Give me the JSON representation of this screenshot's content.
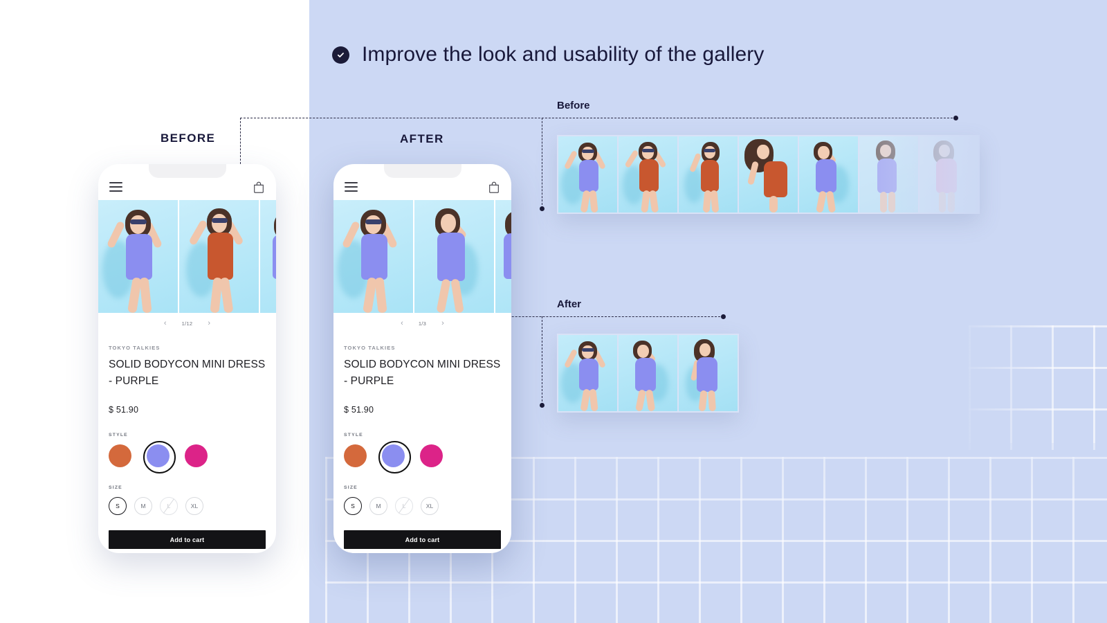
{
  "headline": {
    "icon": "check-circle-icon",
    "text": "Improve the look and usability of the gallery"
  },
  "labels": {
    "before": "BEFORE",
    "after": "AFTER",
    "strip_before": "Before",
    "strip_after": "After"
  },
  "colors": {
    "panel_background": "#ccd8f4",
    "page_background": "#ffffff",
    "ink": "#18183a",
    "accent_purple": "#8b8ef0",
    "accent_orange": "#d4693c",
    "accent_magenta": "#dc2388",
    "button": "#131316"
  },
  "phone_before": {
    "header": {
      "menu_icon": "hamburger-menu-icon",
      "cart_icon": "shopping-bag-icon"
    },
    "gallery": {
      "pager_prev": "‹",
      "pager_next": "›",
      "pager_count": "1/12",
      "total_images": 12,
      "slides": [
        {
          "color": "#8b8ef0",
          "pose": "arms-up"
        },
        {
          "color": "#d4693c",
          "pose": "arms-up"
        },
        {
          "color": "#8b8ef0",
          "pose": "side"
        }
      ]
    },
    "product": {
      "brand": "TOKYO TALKIES",
      "title": "SOLID BODYCON MINI DRESS - PURPLE",
      "price": "$ 51.90",
      "style_label": "STYLE",
      "style_options": [
        {
          "name": "orange",
          "hex": "#d4693c",
          "selected": false
        },
        {
          "name": "purple",
          "hex": "#8b8ef0",
          "selected": true
        },
        {
          "name": "magenta",
          "hex": "#dc2388",
          "selected": false
        }
      ],
      "size_label": "SIZE",
      "size_options": [
        {
          "label": "S",
          "selected": true,
          "disabled": false
        },
        {
          "label": "M",
          "selected": false,
          "disabled": false
        },
        {
          "label": "L",
          "selected": false,
          "disabled": true
        },
        {
          "label": "XL",
          "selected": false,
          "disabled": false
        }
      ],
      "add_to_cart": "Add to cart"
    }
  },
  "phone_after": {
    "header": {
      "menu_icon": "hamburger-menu-icon",
      "cart_icon": "shopping-bag-icon"
    },
    "gallery": {
      "pager_prev": "‹",
      "pager_next": "›",
      "pager_count": "1/3",
      "total_images": 3,
      "slides": [
        {
          "color": "#8b8ef0",
          "pose": "arms-up"
        },
        {
          "color": "#8b8ef0",
          "pose": "hand-head"
        },
        {
          "color": "#8b8ef0",
          "pose": "back"
        }
      ]
    },
    "product": {
      "brand": "TOKYO TALKIES",
      "title": "SOLID BODYCON MINI DRESS - PURPLE",
      "price": "$ 51.90",
      "style_label": "STYLE",
      "style_options": [
        {
          "name": "orange",
          "hex": "#d4693c",
          "selected": false
        },
        {
          "name": "purple",
          "hex": "#8b8ef0",
          "selected": true
        },
        {
          "name": "magenta",
          "hex": "#dc2388",
          "selected": false
        }
      ],
      "size_label": "SIZE",
      "size_options": [
        {
          "label": "S",
          "selected": true,
          "disabled": false
        },
        {
          "label": "M",
          "selected": false,
          "disabled": false
        },
        {
          "label": "L",
          "selected": false,
          "disabled": true
        },
        {
          "label": "XL",
          "selected": false,
          "disabled": false
        }
      ],
      "add_to_cart": "Add to cart"
    }
  },
  "strip_before": {
    "count": 7,
    "thumbnails": [
      {
        "color": "#8b8ef0",
        "pose": "arms-up",
        "faded": false
      },
      {
        "color": "#d4693c",
        "pose": "arms-up",
        "faded": false
      },
      {
        "color": "#d4693c",
        "pose": "side",
        "faded": false
      },
      {
        "color": "#d4693c",
        "pose": "back",
        "faded": false
      },
      {
        "color": "#8b8ef0",
        "pose": "hand-head",
        "faded": false
      },
      {
        "color": "#8b8ef0",
        "pose": "back",
        "faded": true
      },
      {
        "color": "#e592c7",
        "pose": "side",
        "faded": true
      }
    ]
  },
  "strip_after": {
    "count": 3,
    "thumbnails": [
      {
        "color": "#8b8ef0",
        "pose": "arms-up",
        "faded": false
      },
      {
        "color": "#8b8ef0",
        "pose": "hand-head",
        "faded": false
      },
      {
        "color": "#8b8ef0",
        "pose": "back",
        "faded": false
      }
    ]
  }
}
